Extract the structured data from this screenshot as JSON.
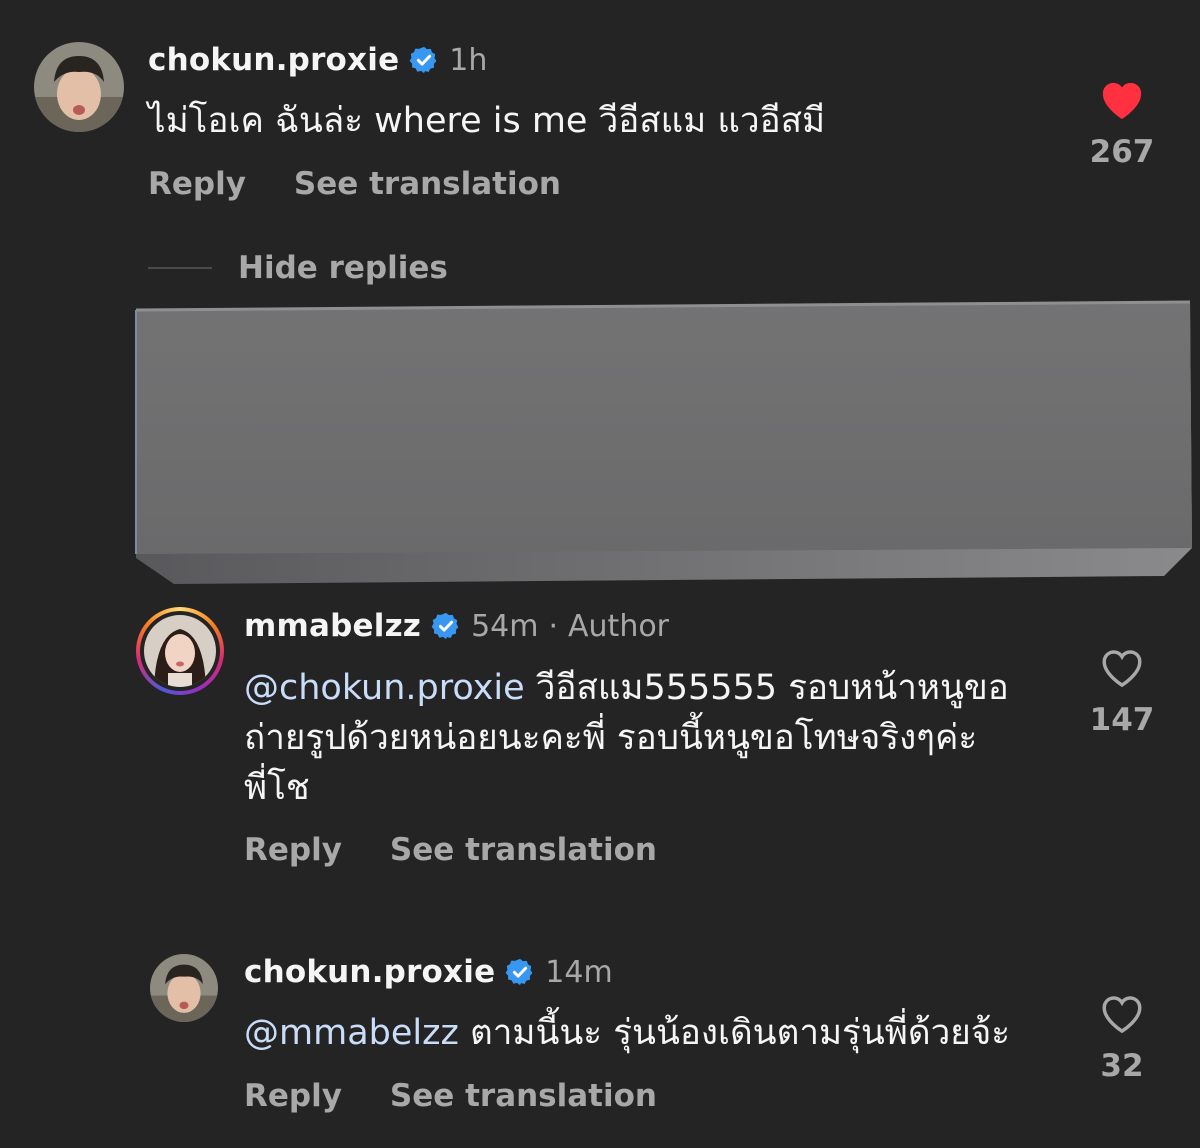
{
  "colors": {
    "background": "#242425",
    "heart_liked": "#ff3040",
    "verified": "#3897f0",
    "mention": "#c9dcf8",
    "muted": "#a8a8a8",
    "redaction": "#6e6e6f"
  },
  "actions": {
    "reply": "Reply",
    "see_translation": "See translation",
    "hide_replies": "Hide replies"
  },
  "comments": [
    {
      "username": "chokun.proxie",
      "verified": true,
      "time": "1h",
      "text": "ไม่โอเค ฉันล่ะ where is me วีอีสแม แวอีสมี",
      "likes": "267",
      "liked": true,
      "icon": "heart-filled-icon"
    },
    {
      "username": "mmabelzz",
      "verified": true,
      "time": "54m",
      "separator": "·",
      "badge": "Author",
      "mention": "@chokun.proxie",
      "text_line1": " วีอีสแม555555 รอบหน้าหนูขอ",
      "text_line2": "ถ่ายรูปด้วยหน่อยนะคะพี่ รอบนี้หนูขอโทษจริงๆค่ะ",
      "text_line3": "พี่โช",
      "likes": "147",
      "liked": false,
      "icon": "heart-outline-icon"
    },
    {
      "username": "chokun.proxie",
      "verified": true,
      "time": "14m",
      "mention": "@mmabelzz",
      "text": " ตามนี้นะ รุ่นน้องเดินตามรุ่นพี่ด้วยจ้ะ",
      "likes": "32",
      "liked": false,
      "icon": "heart-outline-icon"
    }
  ]
}
